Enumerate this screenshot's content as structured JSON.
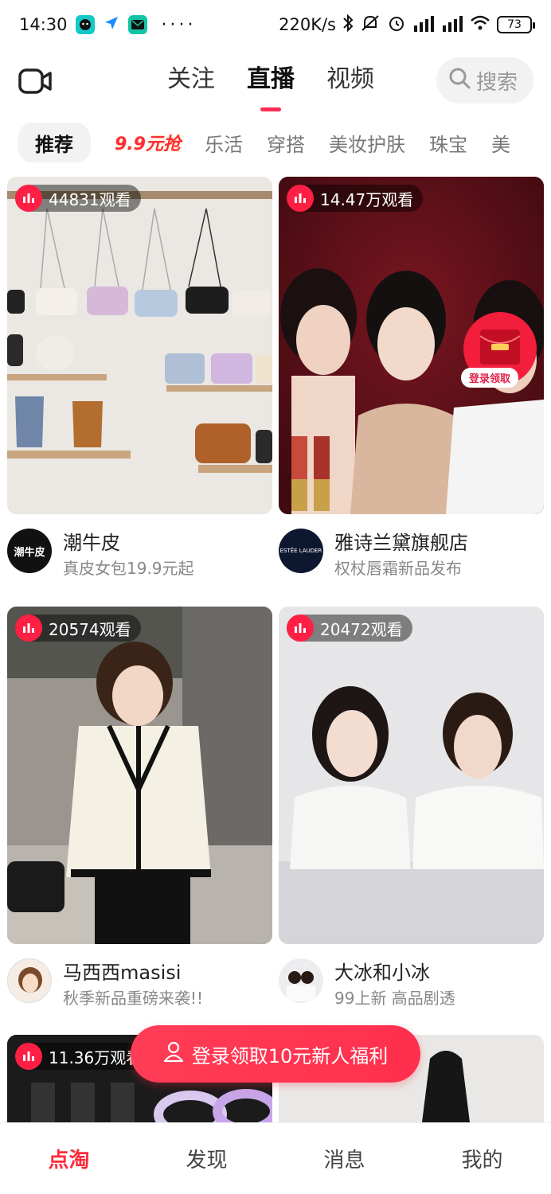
{
  "status_bar": {
    "time": "14:30",
    "dots": "····",
    "net_speed": "220K/s",
    "battery": "73"
  },
  "header": {
    "tabs": [
      {
        "label": "关注",
        "active": false
      },
      {
        "label": "直播",
        "active": true
      },
      {
        "label": "视频",
        "active": false
      }
    ],
    "search_label": "搜索",
    "accent_color": "#ff2a55"
  },
  "categories": [
    "推荐",
    "9.9元抢",
    "乐活",
    "穿搭",
    "美妆护肤",
    "珠宝",
    "美"
  ],
  "cards": [
    {
      "viewers": "44831观看",
      "shop": "潮牛皮",
      "subtitle": "真皮女包19.9元起",
      "avatar_text": "潮牛皮"
    },
    {
      "viewers": "14.47万观看",
      "shop": "雅诗兰黛旗舰店",
      "subtitle": "权杖唇霜新品发布",
      "avatar_text": "ESTĒE LAUDER",
      "envelope_label": "登录领取"
    },
    {
      "viewers": "20574观看",
      "shop": "马西西masisi",
      "subtitle": "秋季新品重磅来袭!!"
    },
    {
      "viewers": "20472观看",
      "shop": "大冰和小冰",
      "subtitle": "99上新 高品剧透"
    },
    {
      "viewers": "11.36万观看"
    },
    {
      "viewers": ""
    }
  ],
  "login_banner": "登录领取10元新人福利",
  "bottom_nav": [
    {
      "label": "点淘",
      "active": true
    },
    {
      "label": "发现",
      "active": false
    },
    {
      "label": "消息",
      "active": false
    },
    {
      "label": "我的",
      "active": false
    }
  ]
}
